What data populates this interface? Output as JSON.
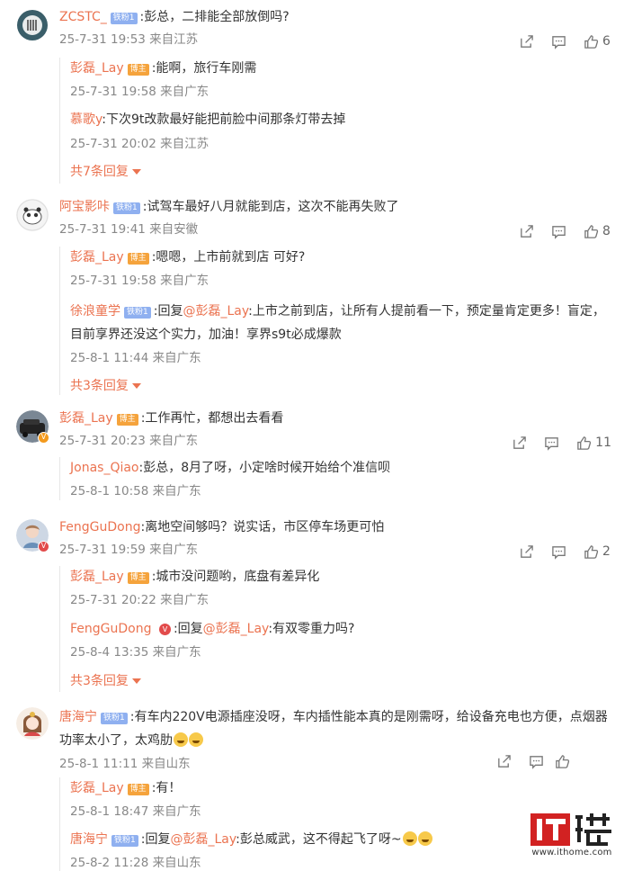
{
  "comments": [
    {
      "user": "ZCSTC_",
      "badge": "铁粉1",
      "text": ":彭总，二排能全部放倒吗?",
      "meta": "25-7-31 19:53 来自江苏",
      "likes": "6",
      "replies": [
        {
          "user": "彭磊_Lay",
          "badge": "博主",
          "text": ":能啊，旅行车刚需",
          "meta": "25-7-31 19:58 来自广东"
        },
        {
          "user": "慕歌y",
          "text": ":下次9t改款最好能把前脸中间那条灯带去掉",
          "meta": "25-7-31 20:02 来自江苏"
        }
      ],
      "more": "共7条回复"
    },
    {
      "user": "阿宝影咔",
      "badge": "铁粉1",
      "text": ":试驾车最好八月就能到店，这次不能再失败了",
      "meta": "25-7-31 19:41 来自安徽",
      "likes": "8",
      "replies": [
        {
          "user": "彭磊_Lay",
          "badge": "博主",
          "text": ":嗯嗯，上市前就到店 可好?",
          "meta": "25-7-31 19:58 来自广东"
        },
        {
          "user": "徐浪童学",
          "badge": "铁粉1",
          "prefix": ":回复",
          "at": "@彭磊_Lay",
          "text": ":上市之前到店，让所有人提前看一下，预定量肯定更多！盲定，目前享界还没这个实力，加油！享界s9t必成爆款",
          "meta": "25-8-1 11:44 来自广东"
        }
      ],
      "more": "共3条回复"
    },
    {
      "user": "彭磊_Lay",
      "badge": "博主",
      "text": ":工作再忙，都想出去看看",
      "meta": "25-7-31 20:23 来自广东",
      "likes": "11",
      "replies": [
        {
          "user": "Jonas_Qiao",
          "text": ":彭总，8月了呀，小定啥时候开始给个准信呗",
          "meta": "25-8-1 10:58 来自广东"
        }
      ]
    },
    {
      "user": "FengGuDong",
      "text": ":离地空间够吗？说实话，市区停车场更可怕",
      "meta": "25-7-31 19:59 来自广东",
      "likes": "2",
      "replies": [
        {
          "user": "彭磊_Lay",
          "badge": "博主",
          "text": ":城市没问题哟，底盘有差异化",
          "meta": "25-7-31 20:22 来自广东"
        },
        {
          "user": "FengGuDong",
          "redbadge": "V",
          "prefix": ":回复",
          "at": "@彭磊_Lay",
          "text": ":有双零重力吗?",
          "meta": "25-8-4 13:35 来自广东"
        }
      ],
      "more": "共3条回复"
    },
    {
      "user": "唐海宁",
      "badge": "铁粉1",
      "text": ":有车内220V电源插座没呀，车内插性能本真的是刚需呀，给设备充电也方便，点烟器功率太小了，太鸡肋",
      "meta": "25-8-1 11:11 来自山东",
      "likes": "",
      "replies": [
        {
          "user": "彭磊_Lay",
          "badge": "博主",
          "text": ":有！",
          "meta": "25-8-1 18:47 来自广东"
        },
        {
          "user": "唐海宁",
          "badge": "铁粉1",
          "prefix": ":回复",
          "at": "@彭磊_Lay",
          "text": ":彭总威武，这不得起飞了呀~",
          "meta": "25-8-2 11:28 来自山东"
        }
      ]
    }
  ],
  "watermark": {
    "logo": "IT之家",
    "url": "www.ithome.com"
  },
  "colors": {
    "accent": "#eb7350",
    "meta": "#888888",
    "watermark_red": "#d22222"
  },
  "icons": {
    "share": "share-icon",
    "comment": "comment-icon",
    "like": "like-icon",
    "expand": "chevron-down-icon"
  }
}
